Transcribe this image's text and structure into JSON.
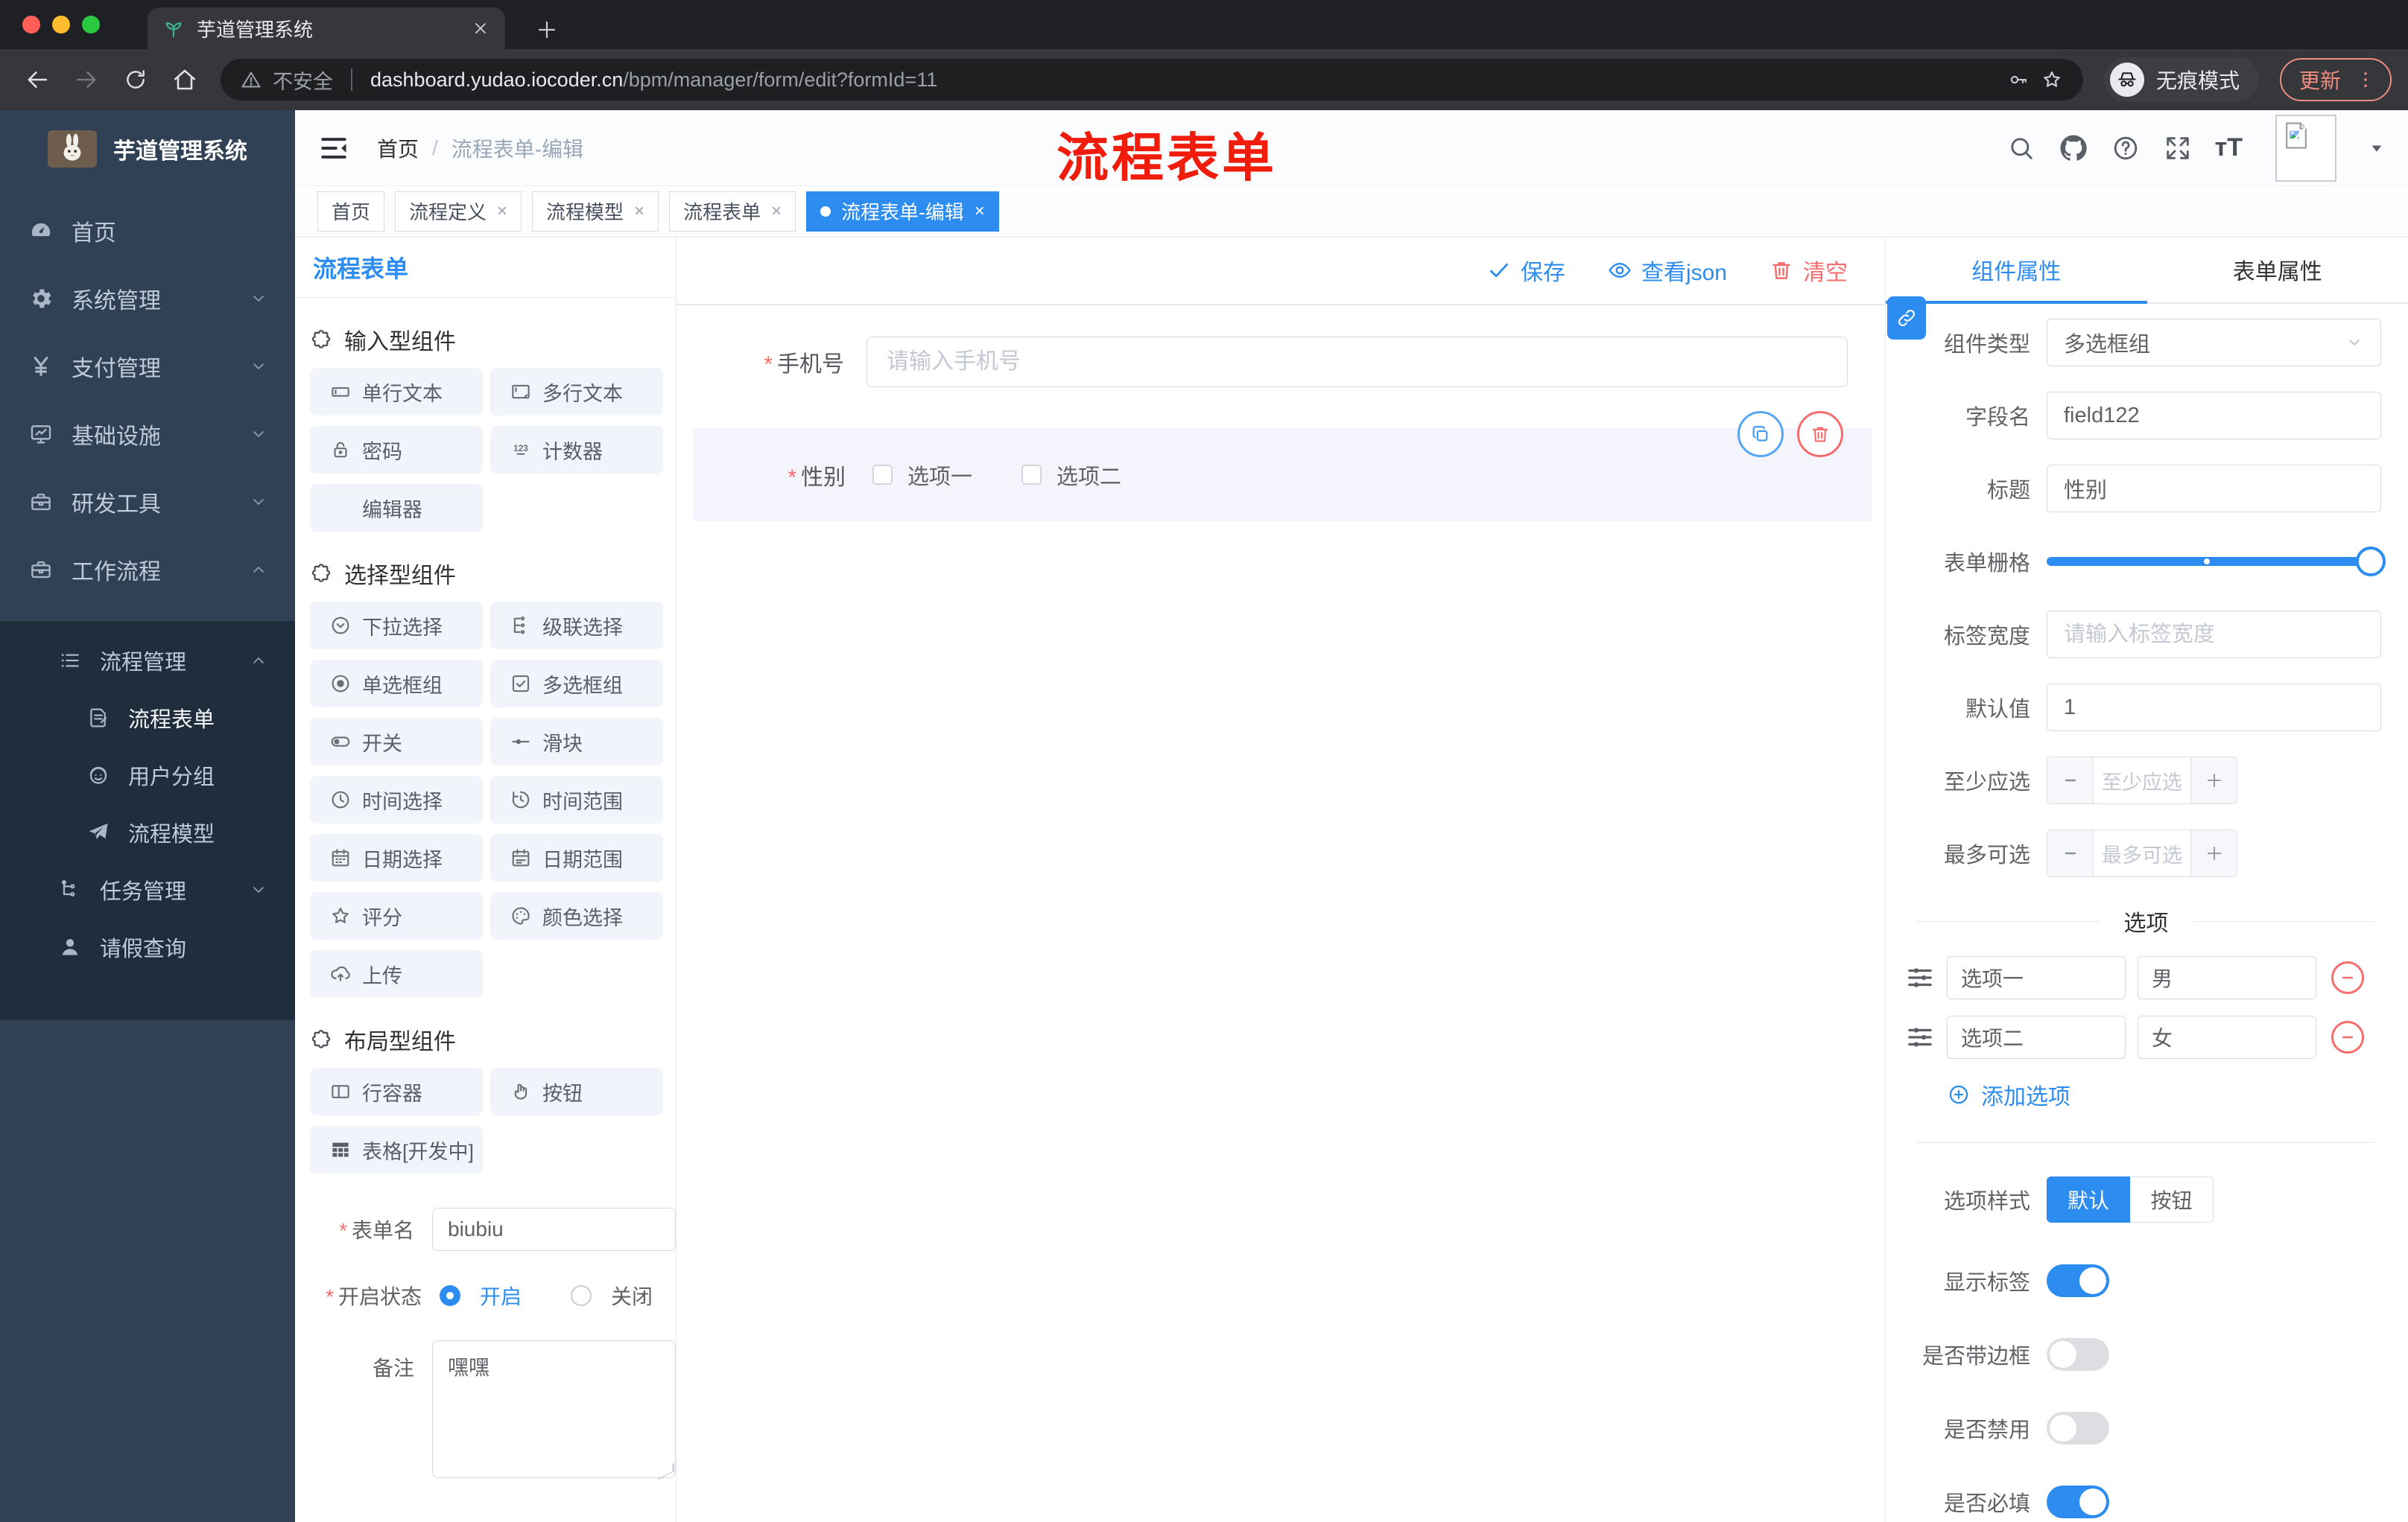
{
  "ui": {
    "required_mark": "*"
  },
  "colors": {
    "accent": "#2d8cf0",
    "danger": "#f56c6c",
    "watermark_red": "#f01c0c",
    "sidebar_bg": "#304156",
    "submenu_bg": "#1f2d3d",
    "chip_bg": "#f2f4fb",
    "selected_block_bg": "#f4f5fc"
  },
  "browser": {
    "tab_title": "芋道管理系统",
    "security": "不安全",
    "url_host": "dashboard.yudao.iocoder.cn",
    "url_path": "/bpm/manager/form/edit?formId=11",
    "incognito": "无痕模式",
    "update": "更新"
  },
  "sidebar": {
    "title": "芋道管理系统",
    "menu": [
      {
        "label": "首页"
      },
      {
        "label": "系统管理"
      },
      {
        "label": "支付管理"
      },
      {
        "label": "基础设施"
      },
      {
        "label": "研发工具"
      },
      {
        "label": "工作流程"
      }
    ],
    "submenu": [
      {
        "label": "流程管理"
      },
      {
        "label": "流程表单"
      },
      {
        "label": "用户分组"
      },
      {
        "label": "流程模型"
      },
      {
        "label": "任务管理"
      },
      {
        "label": "请假查询"
      }
    ]
  },
  "header": {
    "breadcrumb_home": "首页",
    "breadcrumb_sep": "/",
    "breadcrumb_current": "流程表单-编辑",
    "watermark": "流程表单"
  },
  "tags": [
    {
      "label": "首页"
    },
    {
      "label": "流程定义"
    },
    {
      "label": "流程模型"
    },
    {
      "label": "流程表单"
    },
    {
      "label": "流程表单-编辑"
    }
  ],
  "palette": {
    "title": "流程表单",
    "sections": [
      {
        "title": "输入型组件",
        "items": [
          {
            "label": "单行文本"
          },
          {
            "label": "多行文本"
          },
          {
            "label": "密码"
          },
          {
            "label": "计数器"
          },
          {
            "label": "编辑器"
          }
        ]
      },
      {
        "title": "选择型组件",
        "items": [
          {
            "label": "下拉选择"
          },
          {
            "label": "级联选择"
          },
          {
            "label": "单选框组"
          },
          {
            "label": "多选框组"
          },
          {
            "label": "开关"
          },
          {
            "label": "滑块"
          },
          {
            "label": "时间选择"
          },
          {
            "label": "时间范围"
          },
          {
            "label": "日期选择"
          },
          {
            "label": "日期范围"
          },
          {
            "label": "评分"
          },
          {
            "label": "颜色选择"
          },
          {
            "label": "上传"
          }
        ]
      },
      {
        "title": "布局型组件",
        "items": [
          {
            "label": "行容器"
          },
          {
            "label": "按钮"
          },
          {
            "label": "表格[开发中]"
          }
        ]
      }
    ],
    "form": {
      "name_label": "表单名",
      "name_value": "biubiu",
      "status_label": "开启状态",
      "status_on": "开启",
      "status_off": "关闭",
      "remark_label": "备注",
      "remark_value": "嘿嘿"
    }
  },
  "canvas": {
    "save": "保存",
    "view_json": "查看json",
    "clear": "清空",
    "phone_label": "手机号",
    "phone_placeholder": "请输入手机号",
    "gender_label": "性别",
    "option1": "选项一",
    "option2": "选项二"
  },
  "inspector": {
    "tab_component": "组件属性",
    "tab_form": "表单属性",
    "type_label": "组件类型",
    "type_value": "多选框组",
    "field_label": "字段名",
    "field_value": "field122",
    "title_label": "标题",
    "title_value": "性别",
    "grid_label": "表单栅格",
    "labelwidth_label": "标签宽度",
    "labelwidth_placeholder": "请输入标签宽度",
    "default_label": "默认值",
    "default_value": "1",
    "min_label": "至少应选",
    "min_placeholder": "至少应选",
    "max_label": "最多可选",
    "max_placeholder": "最多可选",
    "options_divider": "选项",
    "options": [
      {
        "label": "选项一",
        "value": "男"
      },
      {
        "label": "选项二",
        "value": "女"
      }
    ],
    "add_option": "添加选项",
    "style_label": "选项样式",
    "style_default": "默认",
    "style_button": "按钮",
    "toggle_show_label": "显示标签",
    "toggle_border": "是否带边框",
    "toggle_disabled": "是否禁用",
    "toggle_required": "是否必填"
  }
}
